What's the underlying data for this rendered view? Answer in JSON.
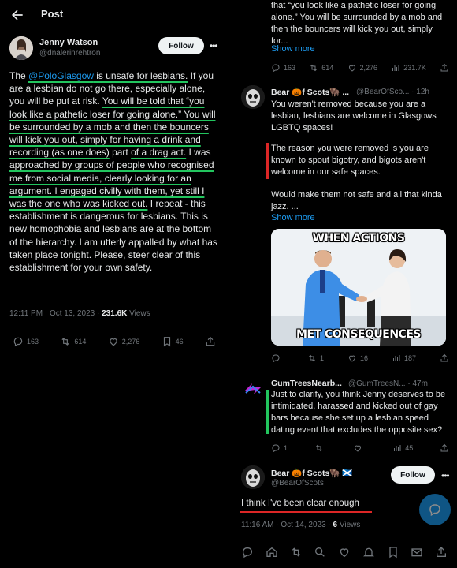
{
  "left": {
    "header": {
      "title": "Post"
    },
    "author": {
      "name": "Jenny Watson",
      "handle": "@dnalerinrehtron",
      "follow_label": "Follow"
    },
    "text": {
      "p1": "The ",
      "mention": "@PoloGlasgow",
      "p2": " is unsafe for lesbians.",
      "p3": " If you are a lesbian do not go there, especially alone, you will be put at risk. ",
      "p4": "You will be told that “you look like a pathetic loser for going alone.” You will be surrounded by a mob and then the bouncers will kick you out, simply for having a drink and recording (as one does)",
      "p5": " part ",
      "p6": "of a drag act.",
      "p7": " I was ",
      "p8": "approached by groups of people who recognised me from social media, clearly looking for an argument. I engaged civilly with them, yet still I was the one who was kicked out.",
      "p9": " I repeat - this establishment is dangerous for lesbians. This is new homophobia and lesbians are at the bottom of the hierarchy. I am utterly appalled by what has taken place tonight. Please, steer clear of this establishment for your own safety."
    },
    "meta": {
      "time": "12:11 PM · Oct 13, 2023 · ",
      "views": "231.6K",
      "views_label": " Views"
    },
    "actions": {
      "replies": "163",
      "reposts": "614",
      "likes": "2,276",
      "bookmarks": "46"
    }
  },
  "right": {
    "top_tweet": {
      "text": "that “you look like a pathetic loser for going alone.” You will be surrounded by a mob and then the bouncers will kick you out, simply for...",
      "show_more": "Show more",
      "actions": {
        "replies": "163",
        "reposts": "614",
        "likes": "2,276",
        "views": "231.7K"
      }
    },
    "bear_reply": {
      "name": "Bear 🎃f Scots🦬 ...",
      "handle": "@BearOfSco... · 12h",
      "text1": "You weren't removed because you are a lesbian, lesbians are welcome in Glasgows LGBTQ spaces!",
      "text2": "The reason you were removed is you are known to spout bigotry, and bigots aren't welcome in our safe spaces.",
      "text3": "Would make them not safe and all that kinda jazz. ...",
      "show_more": "Show more",
      "meme_top": "WHEN ACTIONS",
      "meme_bottom": "MET CONSEQUENCES",
      "actions": {
        "replies": "",
        "reposts": "1",
        "likes": "16",
        "views": "187"
      }
    },
    "gum_reply": {
      "name": "GumTreesNearb...",
      "handle": "@GumTreesN... · 47m",
      "text": "Just to clarify, you think Jenny deserves to be intimidated, harassed and kicked out of gay bars because she set up a lesbian speed dating event that excludes the opposite sex?",
      "actions": {
        "replies": "1",
        "reposts": "",
        "likes": "",
        "views": "45"
      }
    },
    "final_tweet": {
      "name": "Bear 🎃f Scots🦬 🏴󠁧󠁢󠁳󠁣󠁴󠁿",
      "handle": "@BearOfScots",
      "follow_label": "Follow",
      "text": "I think I've been clear enough",
      "time": "11:16 AM · Oct 14, 2023 · ",
      "views": "6",
      "views_label": " Views"
    }
  },
  "colors": {
    "accent": "#1d9bf0",
    "underline_green": "#22c55e",
    "highlight_red": "#dc2626",
    "bg": "#000000",
    "muted": "#71767b"
  }
}
